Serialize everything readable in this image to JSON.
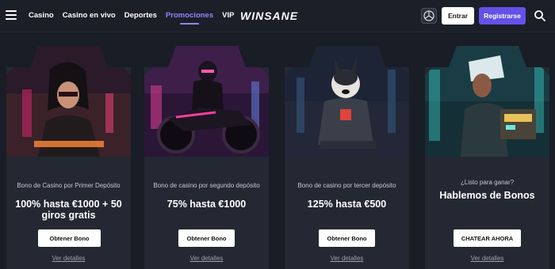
{
  "header": {
    "nav": [
      {
        "label": "Casino",
        "active": false
      },
      {
        "label": "Casino en vivo",
        "active": false
      },
      {
        "label": "Deportes",
        "active": false
      },
      {
        "label": "Promociones",
        "active": true
      },
      {
        "label": "VIP",
        "active": false
      }
    ],
    "logo": "WINSANE",
    "login_label": "Entrar",
    "register_label": "Registrarse"
  },
  "cards": [
    {
      "subtitle": "Bono de Casino por Primer Depósito",
      "title": "100% hasta €1000 + 50 giros gratis",
      "cta": "Obtener Bono",
      "details": "Ver detalles"
    },
    {
      "subtitle": "Bono de casino por segundo depósito",
      "title": "75% hasta €1000",
      "cta": "Obtener Bono",
      "details": "Ver detalles"
    },
    {
      "subtitle": "Bono de casino por tercer depósito",
      "title": "125% hasta €500",
      "cta": "Obtener Bono",
      "details": "Ver detalles"
    },
    {
      "subtitle": "¿Listo para ganar?",
      "title": "Hablemos de Bonos",
      "cta": "CHATEAR AHORA",
      "details": "Ver detalles"
    }
  ],
  "colors": {
    "accent": "#6351e8",
    "active_nav": "#8f87ff",
    "background": "#191d25",
    "card": "#232832"
  }
}
